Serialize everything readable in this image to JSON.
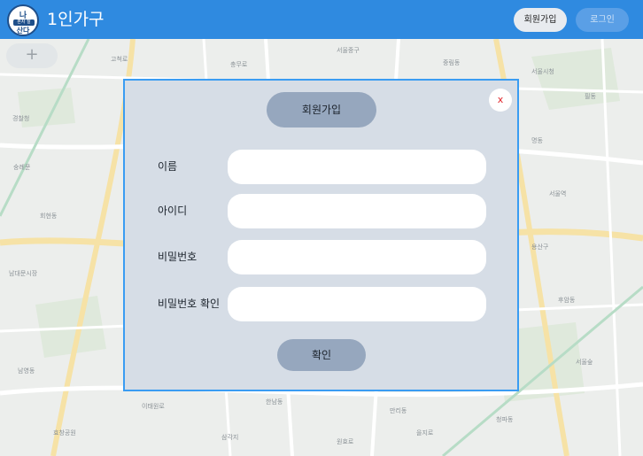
{
  "header": {
    "logo_line1": "나",
    "logo_line2": "혼자 잘",
    "logo_line3": "산다",
    "title": "1인가구",
    "signup_label": "회원가입",
    "login_label": "로그인"
  },
  "map": {
    "zoom_symbol": "+",
    "place_labels": [
      "고척로",
      "서울중구",
      "중림동",
      "서울시청",
      "경찰청",
      "숭례문",
      "회현동",
      "남대문시장",
      "명동",
      "서울역",
      "용산구",
      "후암동",
      "이태원로",
      "한남동",
      "만리동",
      "청파동",
      "효창공원",
      "남영동",
      "삼각지",
      "원효로",
      "서울숲",
      "필동",
      "충무로",
      "을지로"
    ]
  },
  "modal": {
    "title": "회원가입",
    "close_label": "x",
    "fields": [
      {
        "label": "이름",
        "value": "",
        "placeholder": ""
      },
      {
        "label": "아이디",
        "value": "",
        "placeholder": ""
      },
      {
        "label": "비밀번호",
        "value": "",
        "placeholder": ""
      },
      {
        "label": "비밀번호 확인",
        "value": "",
        "placeholder": ""
      }
    ],
    "confirm_label": "확인"
  },
  "colors": {
    "header_bg": "#2f8ae0",
    "modal_bg": "#d6dde6",
    "modal_border": "#3a9cf2",
    "pill_button": "#96a7be",
    "close_text": "#e0242a"
  }
}
